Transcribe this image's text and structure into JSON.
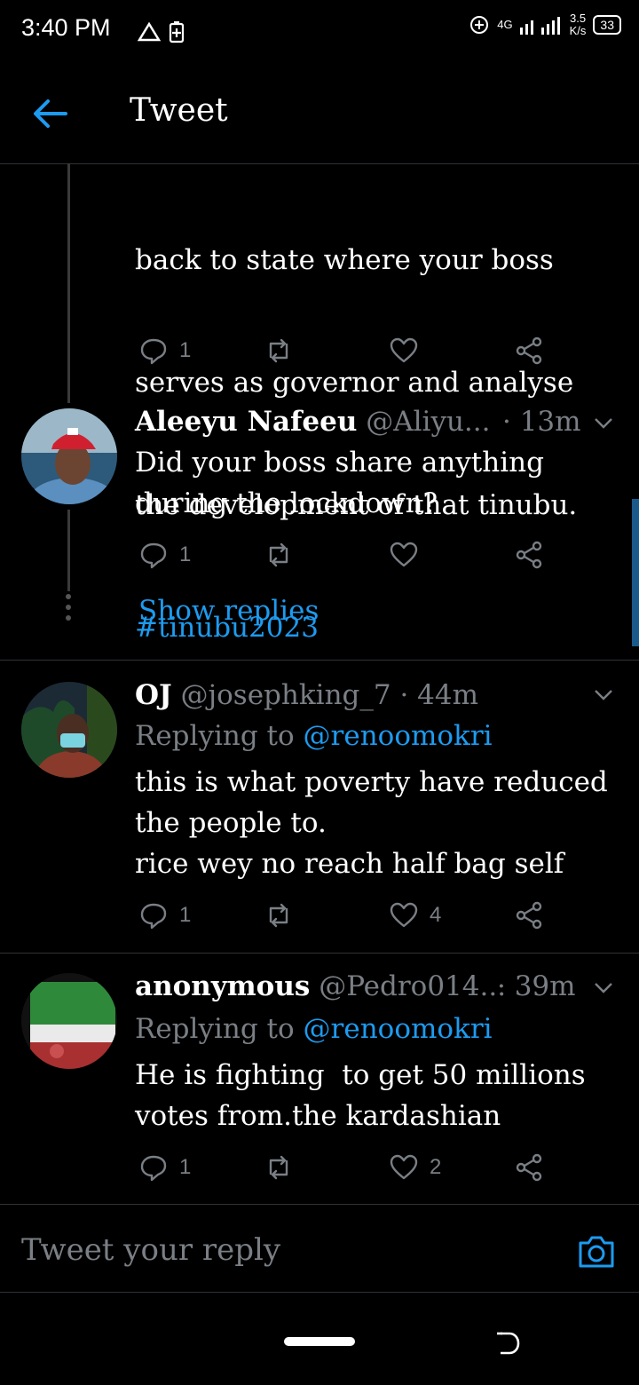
{
  "status_bar": {
    "time": "3:40 PM",
    "network_label": "4G",
    "speed_value": "3.5",
    "speed_unit": "K/s",
    "battery": "33"
  },
  "header": {
    "title": "Tweet"
  },
  "tweets": [
    {
      "text_lines": [
        "back to state where your boss",
        "serves as governor and analyse",
        "the development of that tinubu."
      ],
      "hashtag": "#tinubu2023",
      "replies": "1",
      "retweets": "",
      "likes": ""
    },
    {
      "name": "Aleeyu Nafeeu",
      "handle": "@Aliyu...",
      "time": "· 13m",
      "text": "Did your boss share anything\nduring the lockdown?",
      "replies": "1",
      "retweets": "",
      "likes": "",
      "show_replies": "Show replies"
    },
    {
      "name": "OJ",
      "handle": "@josephking_7",
      "time": "· 44m",
      "replying_prefix": "Replying to",
      "replying_to": "@renoomokri",
      "text": "this is what poverty have reduced\nthe people to.\nrice wey no reach half bag self",
      "replies": "1",
      "retweets": "",
      "likes": "4"
    },
    {
      "name": "anonymous",
      "handle": "@Pedro014...",
      "time": "· 39m",
      "replying_prefix": "Replying to",
      "replying_to": "@renoomokri",
      "text": "He is fighting  to get 50 millions\nvotes from.the kardashian",
      "replies": "1",
      "retweets": "",
      "likes": "2"
    }
  ],
  "reply_box": {
    "placeholder": "Tweet your reply"
  },
  "colors": {
    "accent": "#1d9bf0",
    "muted": "#7a7f85",
    "background": "#000000"
  }
}
